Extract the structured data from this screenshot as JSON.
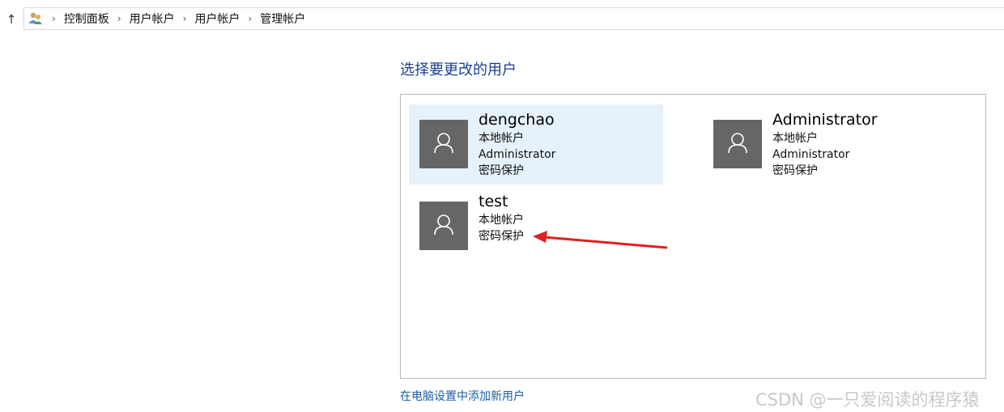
{
  "addressbar": {
    "icon": "users-control-panel-icon",
    "crumbs": [
      "控制面板",
      "用户帐户",
      "用户帐户",
      "管理帐户"
    ]
  },
  "heading": "选择要更改的用户",
  "accounts": [
    {
      "name": "dengchao",
      "lines": [
        "本地帐户",
        "Administrator",
        "密码保护"
      ],
      "selected": true
    },
    {
      "name": "Administrator",
      "lines": [
        "本地帐户",
        "Administrator",
        "密码保护"
      ],
      "selected": false
    },
    {
      "name": "test",
      "lines": [
        "本地帐户",
        "密码保护"
      ],
      "selected": false
    }
  ],
  "add_user_link": "在电脑设置中添加新用户",
  "watermark": "CSDN @一只爱阅读的程序猿",
  "colors": {
    "heading": "#1c3f94",
    "link": "#1a5ea8",
    "selected_bg": "#e5f1fb",
    "avatar_bg": "#666666",
    "annotation_arrow": "#e02020"
  }
}
